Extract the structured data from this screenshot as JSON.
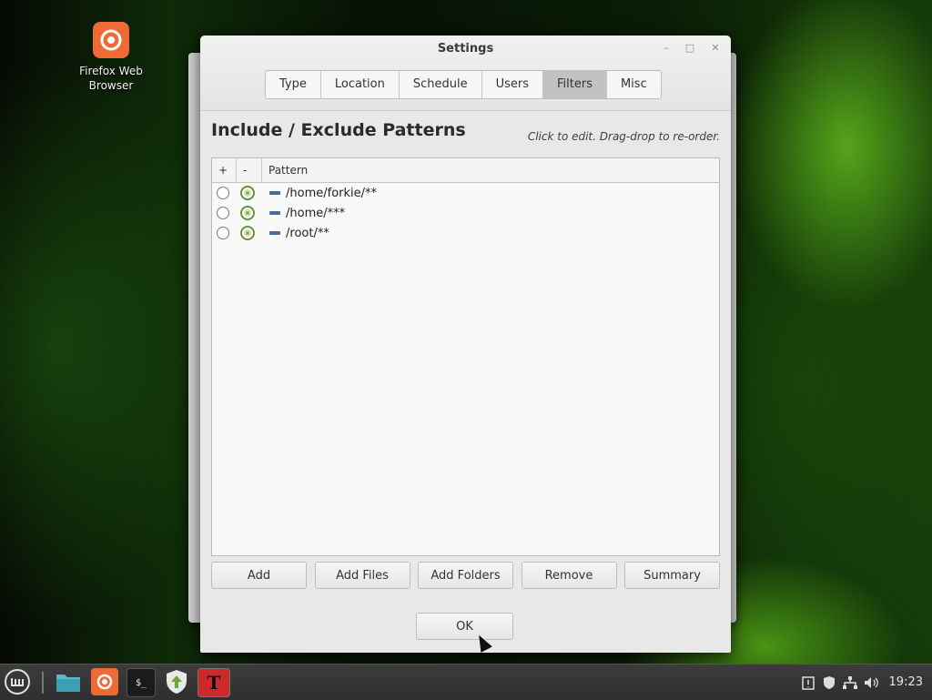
{
  "desktop": {
    "icons": [
      {
        "label": "Firefox Web Browser",
        "icon": "firefox-icon"
      }
    ]
  },
  "window": {
    "title": "Settings",
    "controls": {
      "minimize": "–",
      "maximize": "□",
      "close": "✕"
    },
    "tabs": [
      {
        "label": "Type"
      },
      {
        "label": "Location"
      },
      {
        "label": "Schedule"
      },
      {
        "label": "Users"
      },
      {
        "label": "Filters",
        "active": true
      },
      {
        "label": "Misc"
      }
    ],
    "heading": "Include / Exclude Patterns",
    "hint": "Click to edit. Drag-drop to re-order.",
    "list": {
      "columns": {
        "include": "+",
        "exclude": "-",
        "pattern": "Pattern"
      },
      "rows": [
        {
          "pattern": "/home/forkie/**",
          "include": false,
          "exclude": true
        },
        {
          "pattern": "/home/***",
          "include": false,
          "exclude": true
        },
        {
          "pattern": "/root/**",
          "include": false,
          "exclude": true
        }
      ]
    },
    "buttons": {
      "add": "Add",
      "add_files": "Add Files",
      "add_folders": "Add Folders",
      "remove": "Remove",
      "summary": "Summary",
      "ok": "OK"
    }
  },
  "taskbar": {
    "items": [
      "menu-icon",
      "files-icon",
      "firefox-icon",
      "terminal-icon",
      "update-manager-icon",
      "timeshift-icon"
    ],
    "tray": [
      "clipboard-icon",
      "shield-icon",
      "network-icon",
      "volume-icon"
    ],
    "clock": "19:23"
  },
  "colors": {
    "accent": "#8cb252",
    "firefox": "#f06a35",
    "taskbar": "#333333"
  }
}
